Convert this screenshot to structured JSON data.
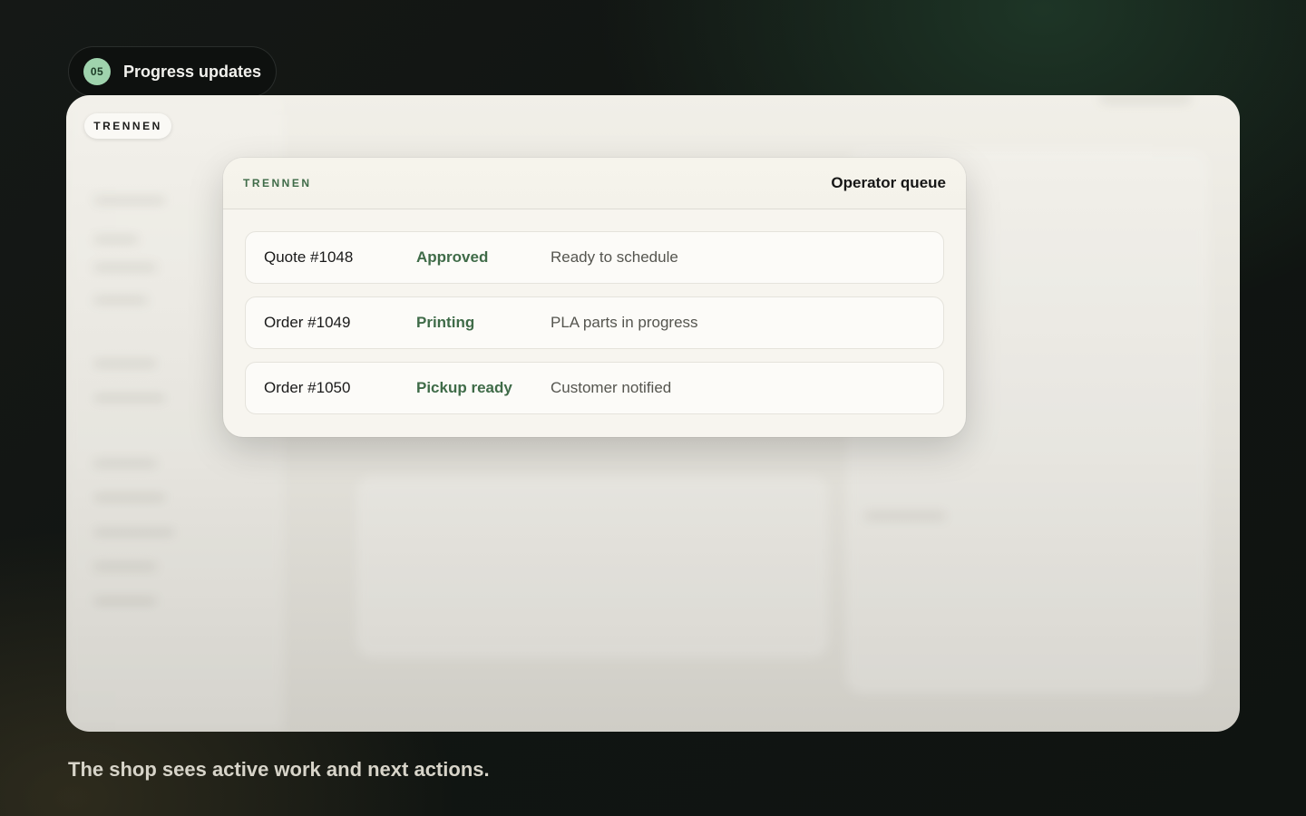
{
  "step": {
    "number": "05",
    "label": "Progress updates"
  },
  "stage": {
    "badge": "TRENNEN"
  },
  "queue": {
    "brand": "TRENNEN",
    "title": "Operator queue",
    "rows": [
      {
        "id": "Quote #1048",
        "status": "Approved",
        "note": "Ready to schedule"
      },
      {
        "id": "Order #1049",
        "status": "Printing",
        "note": "PLA parts in progress"
      },
      {
        "id": "Order #1050",
        "status": "Pickup ready",
        "note": "Customer notified"
      }
    ]
  },
  "caption": "The shop sees active work and next actions.",
  "colors": {
    "accent_green": "#3f6b48",
    "step_badge": "#9fd3ad"
  }
}
